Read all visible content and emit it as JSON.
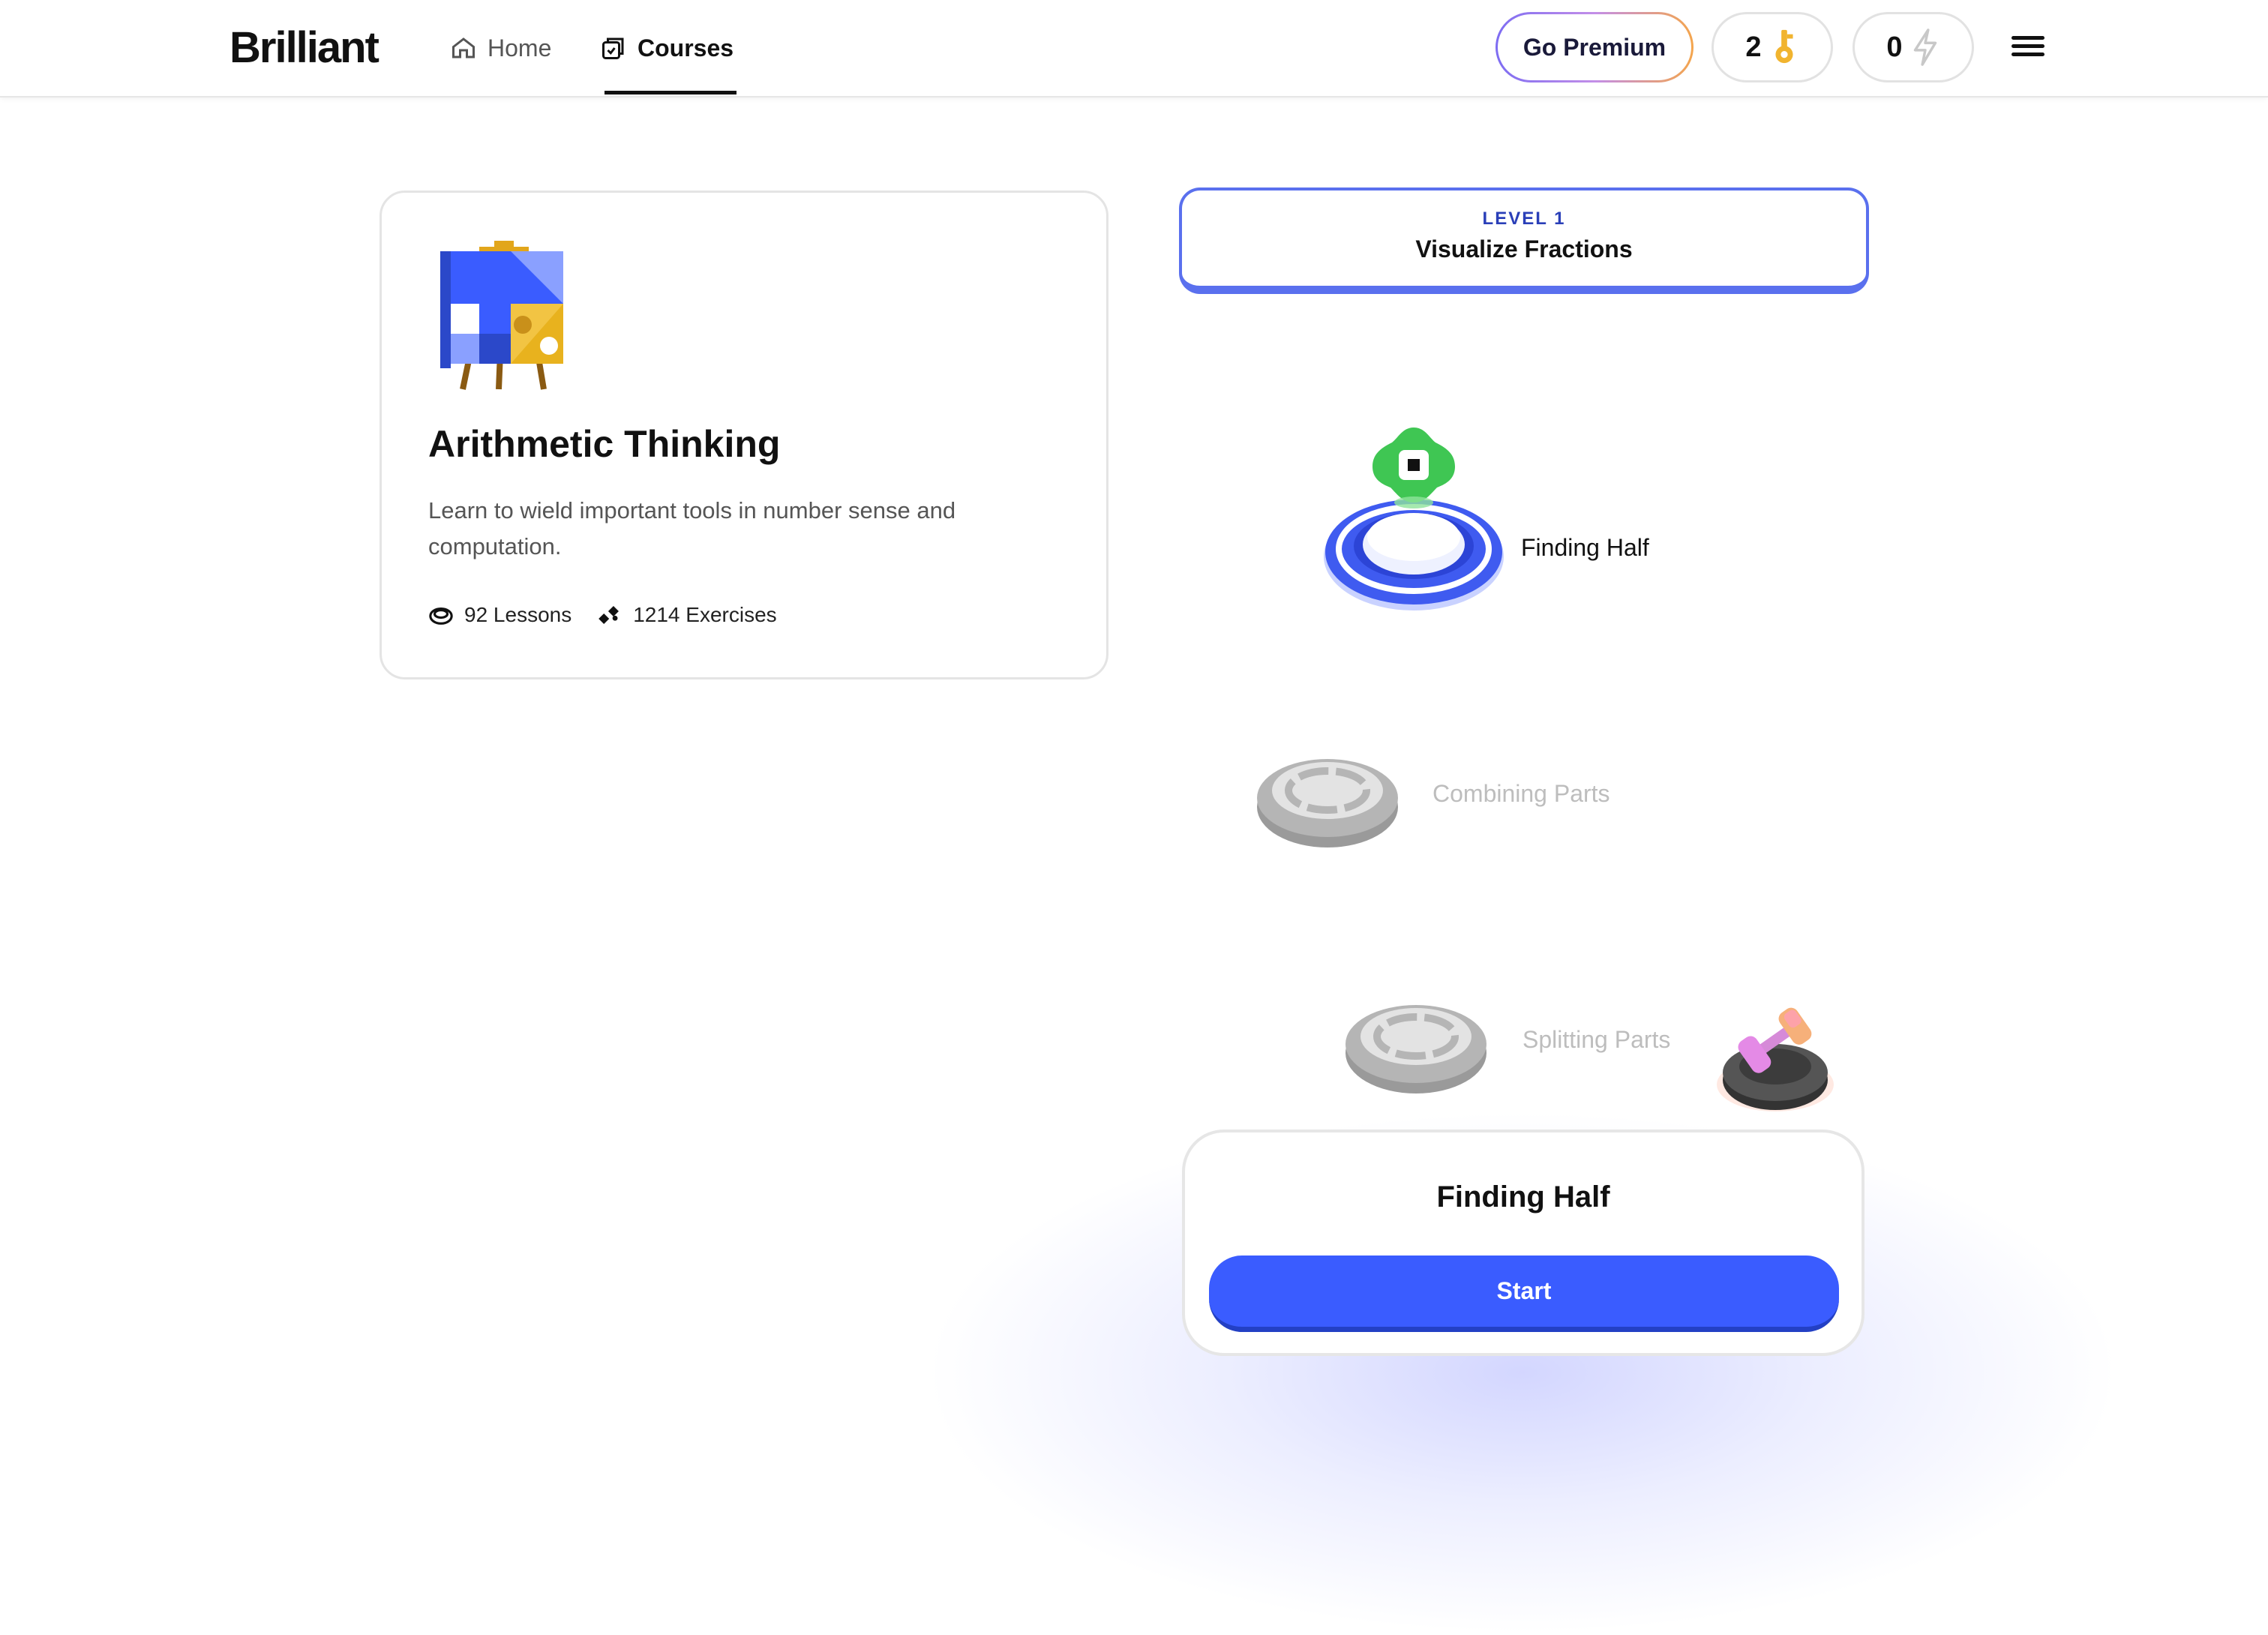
{
  "header": {
    "logo": "Brilliant",
    "nav": [
      {
        "label": "Home",
        "icon": "home-icon",
        "active": false
      },
      {
        "label": "Courses",
        "icon": "courses-icon",
        "active": true
      }
    ],
    "premium_label": "Go Premium",
    "keys_count": "2",
    "energy_count": "0"
  },
  "course": {
    "title": "Arithmetic Thinking",
    "description": "Learn to wield important tools in number sense and computation.",
    "lessons": "92 Lessons",
    "exercises": "1214 Exercises"
  },
  "level": {
    "label": "LEVEL 1",
    "title": "Visualize Fractions"
  },
  "path": [
    {
      "label": "Finding Half",
      "state": "active"
    },
    {
      "label": "Combining Parts",
      "state": "locked"
    },
    {
      "label": "Splitting Parts",
      "state": "locked"
    }
  ],
  "popup": {
    "title": "Finding Half",
    "button": "Start"
  },
  "colors": {
    "accent": "#3a5cff",
    "accent_dark": "#2340c4",
    "level_border": "#5a70ee",
    "active_node": "#3f5bf0",
    "locked_node": "#a8a8a8",
    "key": "#f1b42f",
    "mascot": "#3fc653"
  }
}
